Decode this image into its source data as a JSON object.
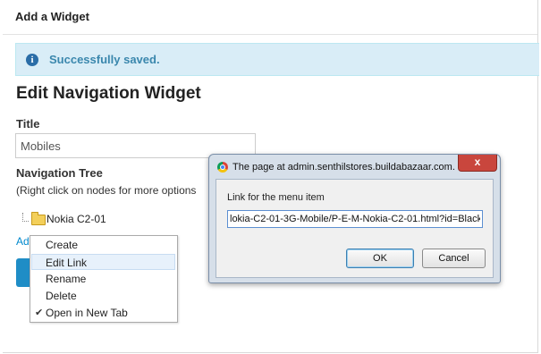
{
  "header": {
    "title": "Add a Widget"
  },
  "alert": {
    "icon": "info-icon",
    "text": "Successfully saved."
  },
  "main": {
    "heading": "Edit Navigation Widget",
    "title_label": "Title",
    "title_value": "Mobiles",
    "nav_label": "Navigation Tree",
    "nav_hint": "(Right click on nodes for more options",
    "tree_node": "Nokia C2-01",
    "add_link": "Ad"
  },
  "context_menu": {
    "items": [
      {
        "label": "Create",
        "checked": false
      },
      {
        "label": "Edit Link",
        "checked": false,
        "hover": true
      },
      {
        "label": "Rename",
        "checked": false
      },
      {
        "label": "Delete",
        "checked": false
      },
      {
        "label": "Open in New Tab",
        "checked": true
      }
    ]
  },
  "dialog": {
    "title": "The page at admin.senthilstores.buildabazaar.com...",
    "close_label": "x",
    "label": "Link for the menu item",
    "input_value": "lokia-C2-01-3G-Mobile/P-E-M-Nokia-C2-01.html?id=Black",
    "ok_label": "OK",
    "cancel_label": "Cancel"
  },
  "colors": {
    "accent": "#1f8dc6",
    "alert_bg": "#d9edf7",
    "alert_text": "#3a87ad",
    "close_red": "#c9463d"
  }
}
